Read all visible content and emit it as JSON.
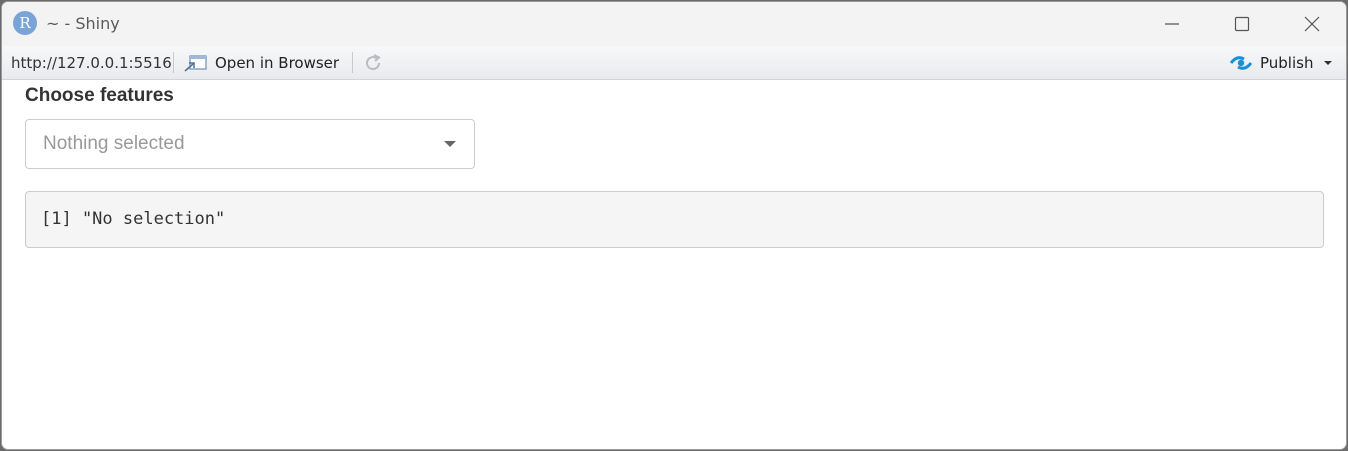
{
  "window": {
    "icon_letter": "R",
    "title": "~ - Shiny"
  },
  "toolbar": {
    "url": "http://127.0.0.1:5516",
    "open_in_browser": "Open in Browser",
    "publish": "Publish"
  },
  "app": {
    "input_label": "Choose features",
    "select_placeholder": "Nothing selected",
    "output_text": "[1] \"No selection\""
  },
  "colors": {
    "accent": "#1a8fd6",
    "output_bg": "#f5f5f5"
  }
}
